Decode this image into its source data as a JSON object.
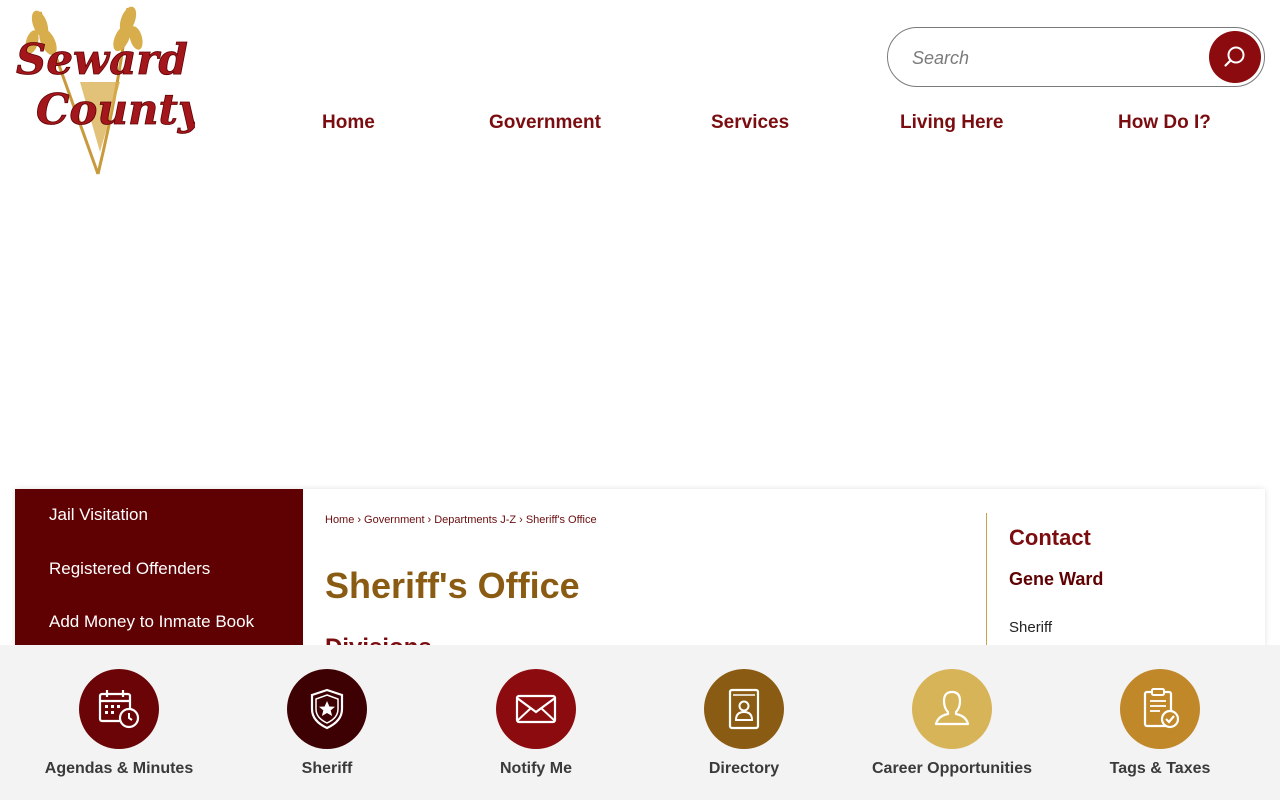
{
  "header": {
    "logo": {
      "line1": "Seward",
      "line2": "County"
    },
    "search": {
      "placeholder": "Search"
    },
    "nav": [
      {
        "label": "Home"
      },
      {
        "label": "Government"
      },
      {
        "label": "Services"
      },
      {
        "label": "Living Here"
      },
      {
        "label": "How Do I?"
      }
    ]
  },
  "side_menu": {
    "items": [
      {
        "label": "Jail Visitation"
      },
      {
        "label": "Registered Offenders"
      },
      {
        "label": "Add Money to Inmate Book"
      }
    ]
  },
  "breadcrumb": [
    {
      "label": "Home"
    },
    {
      "label": "Government"
    },
    {
      "label": "Departments J-Z"
    },
    {
      "label": "Sheriff's Office"
    }
  ],
  "breadcrumb_separator": "›",
  "main": {
    "title": "Sheriff's Office",
    "sub_heading_partial": "Divisions"
  },
  "contact": {
    "heading": "Contact",
    "name": "Gene Ward",
    "role": "Sheriff"
  },
  "quick_links": [
    {
      "label": "Agendas & Minutes",
      "icon": "calendar-clock-icon",
      "color": "#6b0407"
    },
    {
      "label": "Sheriff",
      "icon": "badge-star-icon",
      "color": "#3d0103"
    },
    {
      "label": "Notify Me",
      "icon": "envelope-icon",
      "color": "#8c0b0e"
    },
    {
      "label": "Directory",
      "icon": "address-book-icon",
      "color": "#8a5b12"
    },
    {
      "label": "Career Opportunities",
      "icon": "person-icon",
      "color": "#d8b459"
    },
    {
      "label": "Tags & Taxes",
      "icon": "clipboard-check-icon",
      "color": "#c1882a"
    }
  ],
  "colors": {
    "brand_red": "#7b0d10",
    "menu_bg": "#5f0002",
    "title_gold": "#8a5b12",
    "accent_gold": "#c9a24a"
  }
}
